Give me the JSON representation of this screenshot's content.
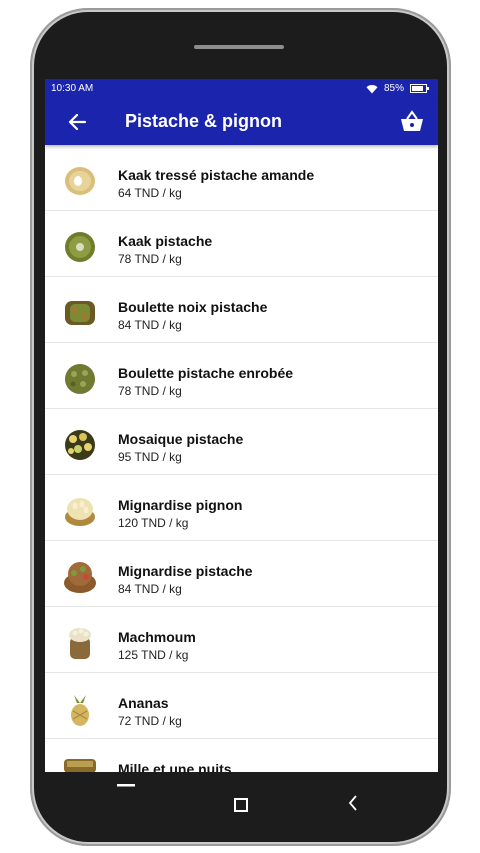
{
  "status_bar": {
    "time": "10:30 AM",
    "battery": "85%"
  },
  "app_bar": {
    "title": "Pistache & pignon",
    "back_icon": "arrow-left-icon",
    "basket_icon": "basket-icon"
  },
  "colors": {
    "primary": "#1b24ad",
    "text": "#111111",
    "divider": "#e6e6e6"
  },
  "products": [
    {
      "name": "Kaak tressé pistache amande",
      "price": "64 TND / kg"
    },
    {
      "name": "Kaak pistache",
      "price": "78 TND / kg"
    },
    {
      "name": "Boulette noix pistache",
      "price": "84 TND / kg"
    },
    {
      "name": "Boulette pistache enrobée",
      "price": "78 TND / kg"
    },
    {
      "name": "Mosaique pistache",
      "price": "95 TND / kg"
    },
    {
      "name": "Mignardise pignon",
      "price": "120 TND / kg"
    },
    {
      "name": "Mignardise pistache",
      "price": "84 TND / kg"
    },
    {
      "name": "Machmoum",
      "price": "125 TND / kg"
    },
    {
      "name": "Ananas",
      "price": "72 TND / kg"
    },
    {
      "name": "Mille et une nuits",
      "price": ""
    }
  ],
  "nav_bar": {
    "recent_icon": "recent-apps-icon",
    "home_icon": "home-square-icon",
    "back_icon": "back-chevron-icon"
  }
}
